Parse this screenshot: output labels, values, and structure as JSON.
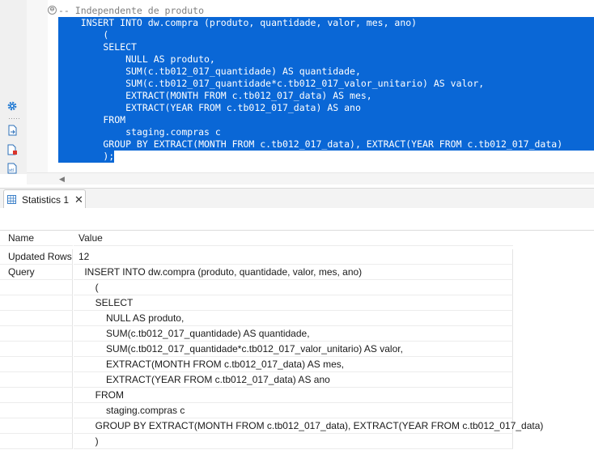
{
  "editor": {
    "fold_marker": "⊖",
    "lines": [
      {
        "text": "-- Independente de produto",
        "kind": "comment"
      },
      {
        "text": "    INSERT INTO dw.compra (produto, quantidade, valor, mes, ano)",
        "kind": "sel"
      },
      {
        "text": "        (",
        "kind": "sel"
      },
      {
        "text": "        SELECT",
        "kind": "sel"
      },
      {
        "text": "            NULL AS produto,",
        "kind": "sel"
      },
      {
        "text": "            SUM(c.tb012_017_quantidade) AS quantidade,",
        "kind": "sel"
      },
      {
        "text": "            SUM(c.tb012_017_quantidade*c.tb012_017_valor_unitario) AS valor,",
        "kind": "sel"
      },
      {
        "text": "            EXTRACT(MONTH FROM c.tb012_017_data) AS mes,",
        "kind": "sel"
      },
      {
        "text": "            EXTRACT(YEAR FROM c.tb012_017_data) AS ano",
        "kind": "sel"
      },
      {
        "text": "        FROM",
        "kind": "sel"
      },
      {
        "text": "            staging.compras c",
        "kind": "sel"
      },
      {
        "text": "        GROUP BY EXTRACT(MONTH FROM c.tb012_017_data), EXTRACT(YEAR FROM c.tb012_017_data)",
        "kind": "sel"
      },
      {
        "text": "        );",
        "kind": "sel"
      }
    ]
  },
  "side_icons": [
    "gear-icon",
    "export-icon",
    "file-error-icon",
    "xml-file-icon"
  ],
  "tab": {
    "label": "Statistics 1",
    "close": "✕"
  },
  "stats": {
    "header": {
      "name": "Name",
      "value": "Value"
    },
    "rows": [
      {
        "name": "Updated Rows",
        "value": "12"
      },
      {
        "name": "Query",
        "value": "    INSERT INTO dw.compra (produto, quantidade, valor, mes, ano)"
      },
      {
        "name": "",
        "value": "        ("
      },
      {
        "name": "",
        "value": "        SELECT"
      },
      {
        "name": "",
        "value": "            NULL AS produto,"
      },
      {
        "name": "",
        "value": "            SUM(c.tb012_017_quantidade) AS quantidade,"
      },
      {
        "name": "",
        "value": "            SUM(c.tb012_017_quantidade*c.tb012_017_valor_unitario) AS valor,"
      },
      {
        "name": "",
        "value": "            EXTRACT(MONTH FROM c.tb012_017_data) AS mes,"
      },
      {
        "name": "",
        "value": "            EXTRACT(YEAR FROM c.tb012_017_data) AS ano"
      },
      {
        "name": "",
        "value": "        FROM"
      },
      {
        "name": "",
        "value": "            staging.compras c"
      },
      {
        "name": "",
        "value": "        GROUP BY EXTRACT(MONTH FROM c.tb012_017_data), EXTRACT(YEAR FROM c.tb012_017_data)"
      },
      {
        "name": "",
        "value": "        )"
      }
    ]
  },
  "colors": {
    "selection": "#0a67d6",
    "comment": "#7f7f7f",
    "gear": "#2b7fd4"
  }
}
